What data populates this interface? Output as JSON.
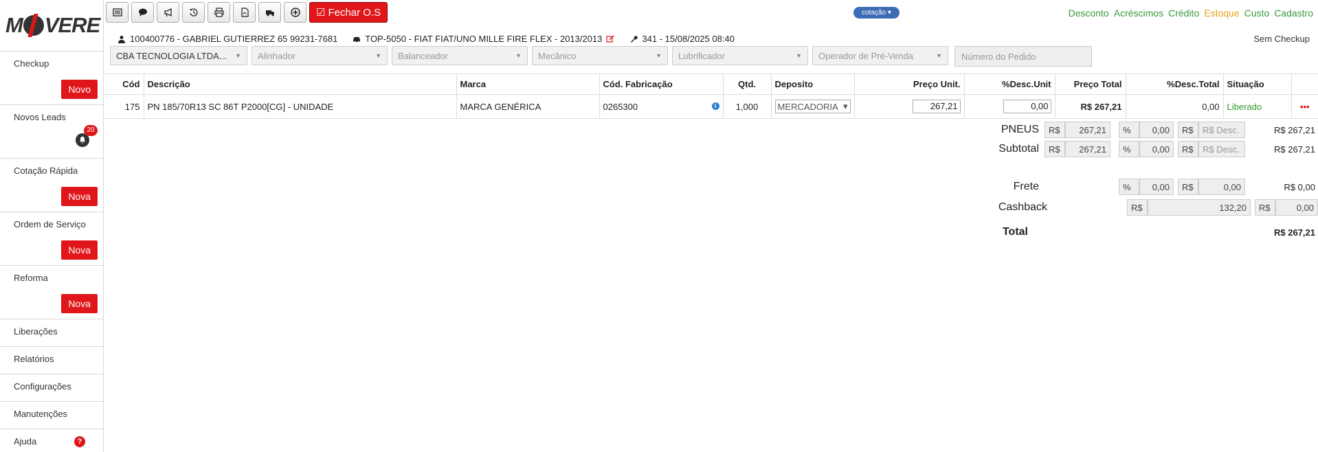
{
  "app": {
    "logo_text_left": "M",
    "logo_text_right": "VERE"
  },
  "sidebar": {
    "items": [
      {
        "label": "Checkup",
        "button": "Novo"
      },
      {
        "label": "Novos Leads",
        "badge": "20"
      },
      {
        "label": "Cotação Rápida",
        "button": "Nova"
      },
      {
        "label": "Ordem de Serviço",
        "button": "Nova"
      },
      {
        "label": "Reforma",
        "button": "Nova"
      },
      {
        "label": "Liberações"
      },
      {
        "label": "Relatórios"
      },
      {
        "label": "Configurações"
      },
      {
        "label": "Manutenções"
      },
      {
        "label": "Ajuda"
      }
    ]
  },
  "toolbar": {
    "buttons": [
      "list-icon",
      "comment-icon",
      "megaphone-icon",
      "history-icon",
      "print-icon",
      "pdf-icon",
      "truck-icon",
      "plus-circle-icon"
    ],
    "fechar_label": "Fechar O.S"
  },
  "status": {
    "cotacao": "cotação"
  },
  "top_links": [
    "Desconto",
    "Acréscimos",
    "Crédito",
    "Estoque",
    "Custo",
    "Cadastro"
  ],
  "info": {
    "client": "100400776 - GABRIEL GUTIERREZ 65 99231-7681",
    "vehicle": "TOP-5050 - FIAT FIAT/UNO MILLE FIRE FLEX - 2013/2013",
    "os": "341 - 15/08/2025 08:40",
    "checkup": "Sem Checkup"
  },
  "filters": {
    "empresa": "CBA TECNOLOGIA LTDA...",
    "alinhador": "Alinhador",
    "balanceador": "Balanceador",
    "mecanico": "Mecânico",
    "lubrificador": "Lubrificador",
    "operador": "Operador de Pré-Venda",
    "pedido_placeholder": "Número do Pedido"
  },
  "table": {
    "headers": [
      "Cód",
      "Descrição",
      "Marca",
      "Cód. Fabricação",
      "Qtd.",
      "Deposito",
      "Preço Unit.",
      "%Desc.Unit",
      "Preço Total",
      "%Desc.Total",
      "Situação"
    ],
    "rows": [
      {
        "cod": "175",
        "descricao": "PN 185/70R13 SC 86T P2000[CG] - UNIDADE",
        "marca": "MARCA GENÉRICA",
        "cod_fab": "0265300",
        "qtd": "1,000",
        "deposito": "MERCADORIA",
        "preco_unit": "267,21",
        "desc_unit": "0,00",
        "preco_total": "R$ 267,21",
        "desc_total": "0,00",
        "situacao": "Liberado"
      }
    ]
  },
  "totals": {
    "pneus": {
      "label": "PNEUS",
      "rs": "R$",
      "value": "267,21",
      "pct": "%",
      "pct_value": "0,00",
      "rs2": "R$",
      "desc_placeholder": "R$ Desc.",
      "total": "R$ 267,21"
    },
    "subtotal": {
      "label": "Subtotal",
      "rs": "R$",
      "value": "267,21",
      "pct": "%",
      "pct_value": "0,00",
      "rs2": "R$",
      "desc_placeholder": "R$ Desc.",
      "total": "R$ 267,21"
    },
    "frete": {
      "label": "Frete",
      "pct": "%",
      "pct_value": "0,00",
      "rs": "R$",
      "value": "0,00",
      "total": "R$ 0,00"
    },
    "cashback": {
      "label": "Cashback",
      "rs": "R$",
      "value": "132,20",
      "rs2": "R$",
      "value2": "0,00"
    },
    "total": {
      "label": "Total",
      "value": "R$ 267,21"
    }
  }
}
